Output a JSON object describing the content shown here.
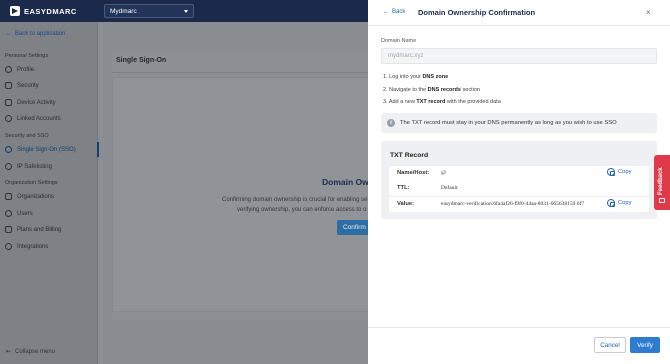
{
  "app": {
    "brand": "EASYDMARC"
  },
  "header": {
    "domain_selected": "Mydmarc"
  },
  "sidebar": {
    "back_label": "Back to application",
    "sections": {
      "personal": "Personal Settings",
      "security": "Security and SSO",
      "organization": "Organization Settings"
    },
    "items": [
      {
        "label": "Profile"
      },
      {
        "label": "Security"
      },
      {
        "label": "Device Activity"
      },
      {
        "label": "Linked Accounts"
      },
      {
        "label": "Single Sign-On (SSO)"
      },
      {
        "label": "IP Safelisting"
      },
      {
        "label": "Organizations"
      },
      {
        "label": "Users"
      },
      {
        "label": "Plans and Billing"
      },
      {
        "label": "Integrations"
      }
    ],
    "collapse_label": "Collapse menu"
  },
  "main": {
    "title": "Single Sign-On",
    "domain_ownership_heading": "Domain Ow",
    "description_line1": "Confirming domain ownership is crucial for enabling se",
    "description_line2": "verifying ownership, you can enforce access to o",
    "confirm_label": "Confirm"
  },
  "drawer": {
    "back_label": "Back",
    "title": "Domain Ownership Confirmation",
    "close_label": "×",
    "domain_name_label": "Domain Name",
    "domain_name_value": "mydmarc.xyz",
    "steps": [
      {
        "num": "1.",
        "pre": "Log into your ",
        "bold": "DNS zone",
        "post": ""
      },
      {
        "num": "2.",
        "pre": "Navigate to the ",
        "bold": "DNS records",
        "post": " section"
      },
      {
        "num": "3.",
        "pre": "Add a new ",
        "bold": "TXT record",
        "post": " with the provided data"
      }
    ],
    "info_text": "The TXT record must stay in your DNS permanently as long as you wish to use SSO",
    "txt_record": {
      "title": "TXT Record",
      "rows": [
        {
          "label": "Name/Host:",
          "value": "@",
          "copy": "Copy"
        },
        {
          "label": "TTL:",
          "value": "Default",
          "copy": ""
        },
        {
          "label": "Value:",
          "value": "easydmarc-verification:6fa4af26-f9f0-44aa-8031-665638159 6f7",
          "copy": "Copy"
        }
      ]
    },
    "cancel_label": "Cancel",
    "verify_label": "Verify"
  },
  "feedback": {
    "label": "Feedback"
  }
}
